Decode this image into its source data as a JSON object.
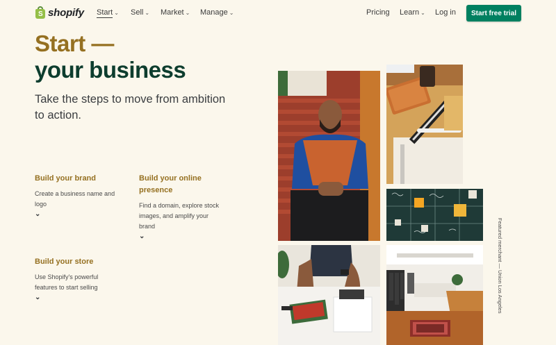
{
  "nav": {
    "logo_text": "shopify",
    "logo_letter": "S",
    "items": [
      {
        "label": "Start"
      },
      {
        "label": "Sell"
      },
      {
        "label": "Market"
      },
      {
        "label": "Manage"
      }
    ],
    "pricing": "Pricing",
    "learn": "Learn",
    "login": "Log in",
    "cta": "Start free trial",
    "chevron": "⌄"
  },
  "hero": {
    "title_line1": "Start —",
    "title_line2": "your business",
    "lead": "Take the steps to move from ambition to action."
  },
  "features": [
    {
      "title": "Build your brand",
      "desc": "Create a business name and logo"
    },
    {
      "title": "Build your online presence",
      "desc": "Find a domain, explore stock images, and amplify your brand"
    },
    {
      "title": "Build your store",
      "desc": "Use Shopify's powerful features to start selling"
    }
  ],
  "arrow_glyph": "⌄",
  "caption": "Featured merchant — Union Los Angeles",
  "colors": {
    "background": "#fbf7ec",
    "brand_green": "#008060",
    "gold": "#957021",
    "dark_green": "#0d3d2e"
  }
}
